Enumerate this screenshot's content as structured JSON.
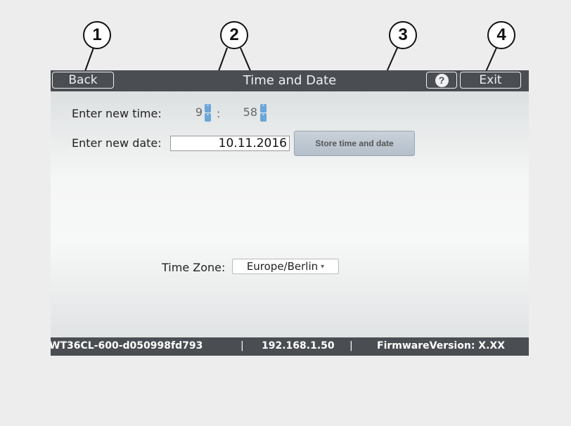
{
  "callouts": [
    "1",
    "2",
    "3",
    "4"
  ],
  "header": {
    "back_label": "Back",
    "title": "Time and Date",
    "help_glyph": "?",
    "exit_label": "Exit"
  },
  "time": {
    "label": "Enter new time:",
    "hour": "9",
    "separator": ":",
    "minute": "58"
  },
  "date": {
    "label": "Enter new date:",
    "value": "10.11.2016"
  },
  "store_button_label": "Store time and date",
  "timezone": {
    "label": "Time Zone:",
    "selected": "Europe/Berlin"
  },
  "footer": {
    "device_id": "WT36CL-600-d050998fd793",
    "sep1": "|",
    "ip": "192.168.1.50",
    "sep2": "|",
    "firmware": "FirmwareVersion: X.XX"
  }
}
